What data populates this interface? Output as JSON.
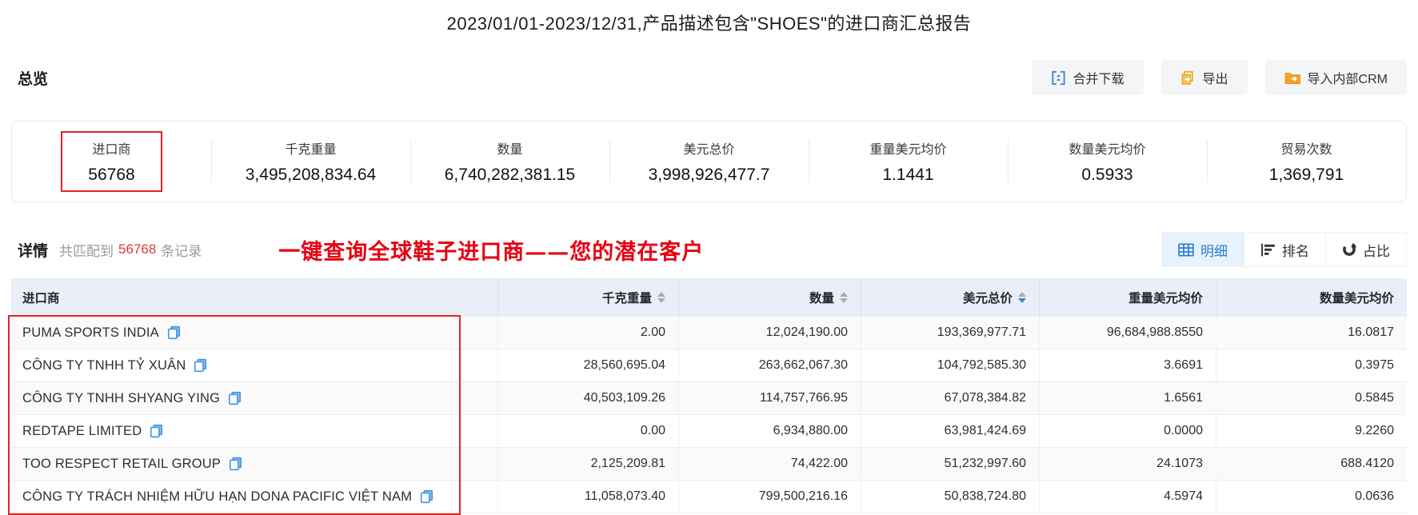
{
  "title": "2023/01/01-2023/12/31,产品描述包含\"SHOES\"的进口商汇总报告",
  "overview": {
    "heading": "总览",
    "actions": [
      {
        "label": "合并下载",
        "icon": "merge-download-icon"
      },
      {
        "label": "导出",
        "icon": "export-icon"
      },
      {
        "label": "导入内部CRM",
        "icon": "import-crm-icon"
      }
    ],
    "stats": [
      {
        "label": "进口商",
        "value": "56768",
        "highlighted": true
      },
      {
        "label": "千克重量",
        "value": "3,495,208,834.64"
      },
      {
        "label": "数量",
        "value": "6,740,282,381.15"
      },
      {
        "label": "美元总价",
        "value": "3,998,926,477.7"
      },
      {
        "label": "重量美元均价",
        "value": "1.1441"
      },
      {
        "label": "数量美元均价",
        "value": "0.5933"
      },
      {
        "label": "贸易次数",
        "value": "1,369,791"
      }
    ]
  },
  "detail": {
    "heading": "详情",
    "match_prefix": "共匹配到",
    "match_count": "56768",
    "match_suffix": "条记录",
    "annotation": "一键查询全球鞋子进口商——您的潜在客户",
    "view_tabs": [
      {
        "label": "明细",
        "icon": "table-view-icon",
        "active": true
      },
      {
        "label": "排名",
        "icon": "ranking-icon",
        "active": false
      },
      {
        "label": "占比",
        "icon": "pie-ratio-icon",
        "active": false
      }
    ]
  },
  "table": {
    "columns": [
      {
        "label": "进口商",
        "is_name_col": true
      },
      {
        "label": "千克重量",
        "sortable": true
      },
      {
        "label": "数量",
        "sortable": true
      },
      {
        "label": "美元总价",
        "sortable": true,
        "sort_desc": true
      },
      {
        "label": "重量美元均价"
      },
      {
        "label": "数量美元均价"
      }
    ],
    "rows": [
      {
        "importer": "PUMA SPORTS INDIA",
        "kg": "2.00",
        "qty": "12,024,190.00",
        "usd": "193,369,977.71",
        "usd_per_kg": "96,684,988.8550",
        "usd_per_qty": "16.0817"
      },
      {
        "importer": "CÔNG TY TNHH TỶ XUÂN",
        "kg": "28,560,695.04",
        "qty": "263,662,067.30",
        "usd": "104,792,585.30",
        "usd_per_kg": "3.6691",
        "usd_per_qty": "0.3975"
      },
      {
        "importer": "CÔNG TY TNHH SHYANG YING",
        "kg": "40,503,109.26",
        "qty": "114,757,766.95",
        "usd": "67,078,384.82",
        "usd_per_kg": "1.6561",
        "usd_per_qty": "0.5845"
      },
      {
        "importer": "REDTAPE LIMITED",
        "kg": "0.00",
        "qty": "6,934,880.00",
        "usd": "63,981,424.69",
        "usd_per_kg": "0.0000",
        "usd_per_qty": "9.2260"
      },
      {
        "importer": "TOO RESPECT RETAIL GROUP",
        "kg": "2,125,209.81",
        "qty": "74,422.00",
        "usd": "51,232,997.60",
        "usd_per_kg": "24.1073",
        "usd_per_qty": "688.4120"
      },
      {
        "importer": "CÔNG TY TRÁCH NHIỆM HỮU HẠN DONA PACIFIC VIỆT NAM",
        "kg": "11,058,073.40",
        "qty": "799,500,216.16",
        "usd": "50,838,724.80",
        "usd_per_kg": "4.5974",
        "usd_per_qty": "0.0636"
      }
    ]
  },
  "colors": {
    "accent_blue": "#2b7cd3",
    "annotation_red": "#e60012",
    "icon_orange": "#efa827",
    "table_header_bg": "#e9eef8"
  }
}
